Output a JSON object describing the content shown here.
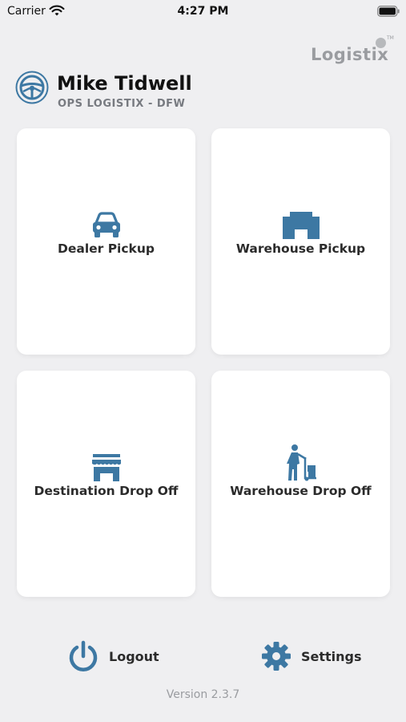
{
  "status_bar": {
    "carrier": "Carrier",
    "time": "4:27 PM"
  },
  "brand": {
    "name": "Logistix",
    "trademark": "TM"
  },
  "profile": {
    "name": "Mike Tidwell",
    "company": "OPS LOGISTIX - DFW",
    "icon": "steering-wheel-icon"
  },
  "tiles": [
    {
      "label": "Dealer Pickup",
      "icon": "car-icon"
    },
    {
      "label": "Warehouse Pickup",
      "icon": "warehouse-icon"
    },
    {
      "label": "Destination Drop Off",
      "icon": "storefront-icon"
    },
    {
      "label": "Warehouse Drop Off",
      "icon": "hand-truck-icon"
    }
  ],
  "actions": {
    "logout_label": "Logout",
    "settings_label": "Settings"
  },
  "version": "Version 2.3.7",
  "colors": {
    "background": "#efeff1",
    "accent": "#3d78a3",
    "tile": "#ffffff",
    "muted": "#9a9ca0"
  }
}
